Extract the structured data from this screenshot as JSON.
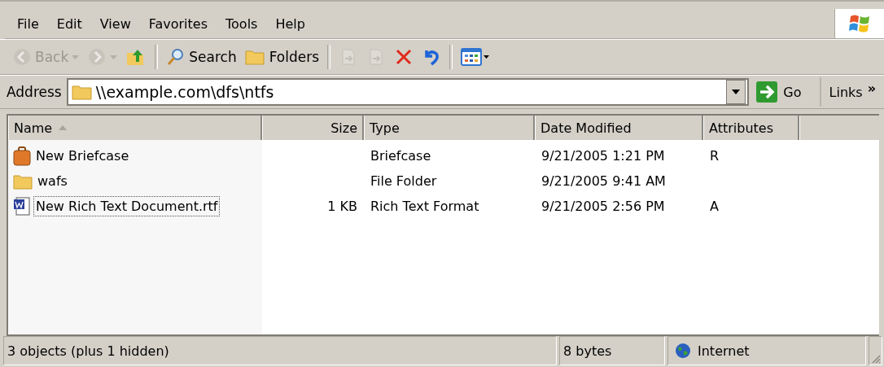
{
  "menu": [
    "File",
    "Edit",
    "View",
    "Favorites",
    "Tools",
    "Help"
  ],
  "toolbar": [
    {
      "kind": "back",
      "label": "Back",
      "disabled": true
    },
    {
      "kind": "forward",
      "disabled": true
    },
    {
      "kind": "up",
      "disabled": false
    },
    {
      "kind": "sep"
    },
    {
      "kind": "search",
      "label": "Search",
      "disabled": false
    },
    {
      "kind": "folders",
      "label": "Folders",
      "disabled": false
    },
    {
      "kind": "sep"
    },
    {
      "kind": "moveto",
      "disabled": true
    },
    {
      "kind": "copyto",
      "disabled": true
    },
    {
      "kind": "delete",
      "disabled": false
    },
    {
      "kind": "undo",
      "disabled": false
    },
    {
      "kind": "sep"
    },
    {
      "kind": "views",
      "disabled": false
    }
  ],
  "address": {
    "label": "Address",
    "value": "\\\\example.com\\dfs\\ntfs",
    "go": "Go",
    "links": "Links",
    "more": "»"
  },
  "columns": [
    {
      "label": "Name",
      "sorted": true
    },
    {
      "label": "Size",
      "sorted": false
    },
    {
      "label": "Type",
      "sorted": false
    },
    {
      "label": "Date Modified",
      "sorted": false
    },
    {
      "label": "Attributes",
      "sorted": false
    }
  ],
  "rows": [
    {
      "kind": "briefcase",
      "name": "New Briefcase",
      "size": "",
      "type": "Briefcase",
      "date": "9/21/2005 1:21 PM",
      "attributes": "R",
      "focused": false
    },
    {
      "kind": "folder",
      "name": "wafs",
      "size": "",
      "type": "File Folder",
      "date": "9/21/2005 9:41 AM",
      "attributes": "",
      "focused": false
    },
    {
      "kind": "document",
      "name": "New Rich Text Document.rtf",
      "size": "1 KB",
      "type": "Rich Text Format",
      "date": "9/21/2005 2:56 PM",
      "attributes": "A",
      "focused": true
    }
  ],
  "status_bar": {
    "objects": "3 objects (plus 1 hidden)",
    "size": "8 bytes",
    "zone": "Internet"
  }
}
